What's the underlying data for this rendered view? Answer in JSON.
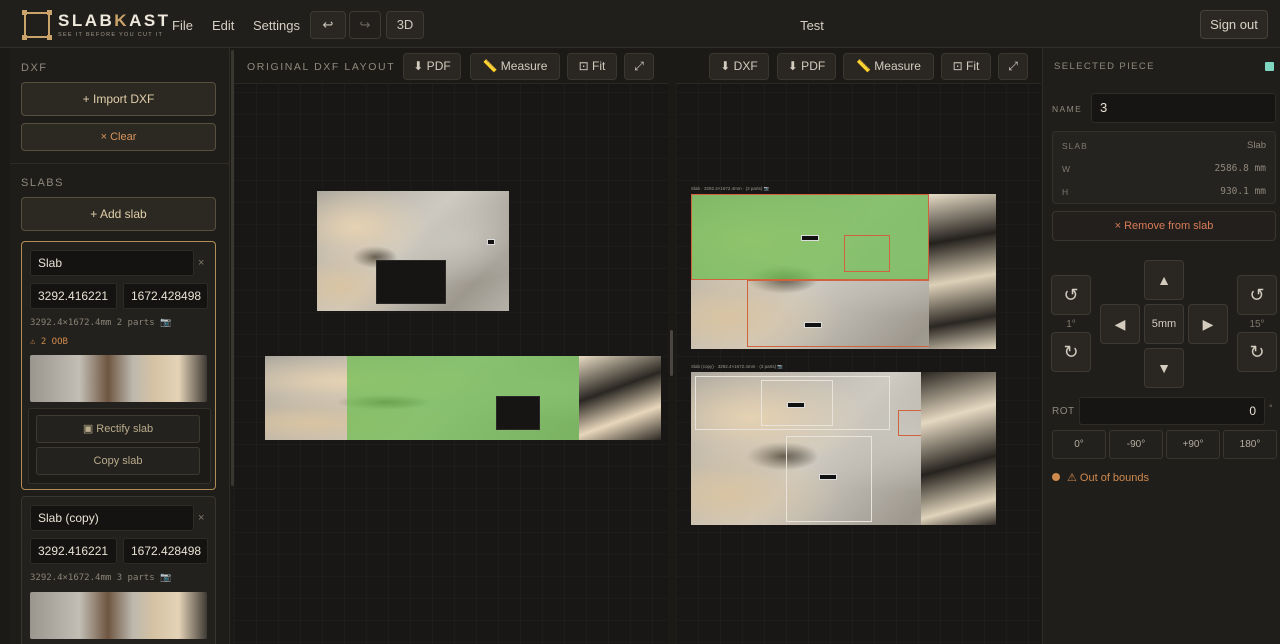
{
  "app": {
    "name": "SLABKAST",
    "tagline": "SEE IT BEFORE YOU CUT IT",
    "doc_title": "Test",
    "menus": [
      "File",
      "Edit",
      "Settings"
    ],
    "toolbar": {
      "undo": "↩",
      "redo": "↪",
      "view3d": "3D"
    },
    "sign_out": "Sign out"
  },
  "sidebar": {
    "dxf_label": "DXF",
    "import_label": "+ Import DXF",
    "clear_label": "× Clear",
    "slabs_label": "SLABS",
    "add_slab_label": "+ Add slab",
    "slabs": [
      {
        "name": "Slab",
        "width": "3292.416221",
        "height": "1672.428498",
        "meta": "3292.4×1672.4mm 2 parts 📷",
        "warning": "⚠ 2 OOB",
        "rectify_label": "▣ Rectify slab",
        "copy_label": "Copy slab"
      },
      {
        "name": "Slab (copy)",
        "width": "3292.416221",
        "height": "1672.428498",
        "meta": "3292.4×1672.4mm 3 parts 📷"
      }
    ],
    "remove_mark": "×"
  },
  "center": {
    "title": "ORIGINAL DXF LAYOUT",
    "tools": [
      "⬇ PDF",
      "📏 Measure",
      "⊡ Fit",
      "⤢"
    ]
  },
  "right_canvas": {
    "tools": [
      "⬇ DXF",
      "⬇ PDF",
      "📏 Measure",
      "⊡ Fit",
      "⤢"
    ],
    "slab1_label": "Slab · 3292.4×1672.4mm · (2 parts) 📷",
    "slab2_label": "Slab (copy) · 3292.4×1672.4mm · (3 parts) 📷"
  },
  "selected_piece": {
    "title": "SELECTED PIECE",
    "name_label": "NAME",
    "name_value": "3",
    "slab_key": "SLAB",
    "slab_value": "Slab",
    "w_key": "W",
    "w_value": "2586.8 mm",
    "h_key": "H",
    "h_value": "930.1 mm",
    "remove_label": "× Remove from slab",
    "rotate_ccw": "↺",
    "rotate_cw": "↻",
    "step_small": "1°",
    "step_large": "15°",
    "nudge_up": "▲",
    "nudge_down": "▼",
    "nudge_left": "◀",
    "nudge_right": "▶",
    "nudge_step": "5mm",
    "rot_label": "ROT",
    "rot_value": "0",
    "rot_unit": "°",
    "rot_presets": [
      "0°",
      "-90°",
      "+90°",
      "180°"
    ],
    "status": "⚠ Out of bounds",
    "accent_color": "#7fd6c0",
    "warning_color": "#d08a4e"
  }
}
